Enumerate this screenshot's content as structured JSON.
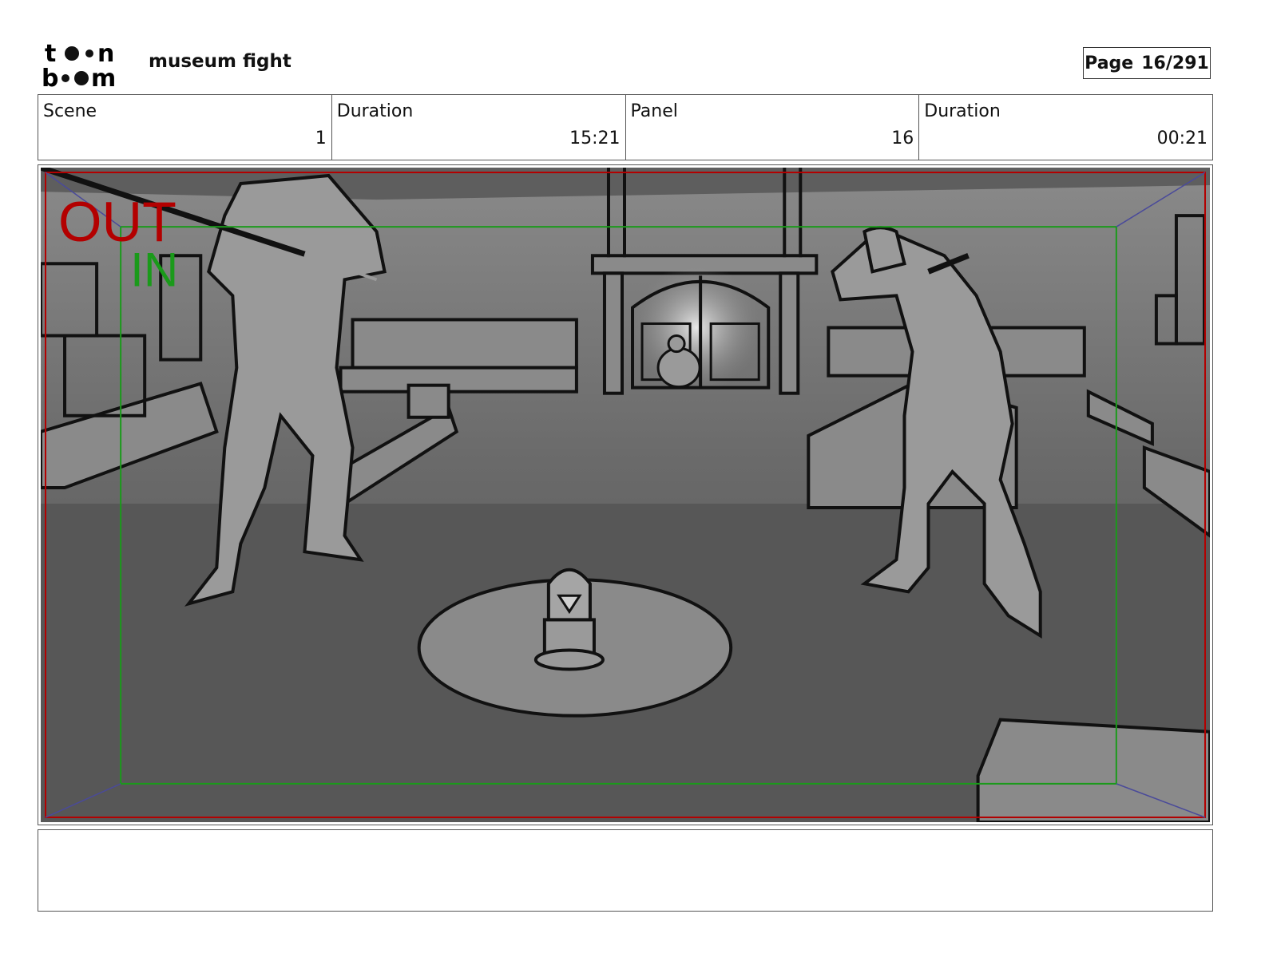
{
  "header": {
    "logo_text_top": "toon",
    "logo_text_bottom": "boom",
    "project_title": "museum fight",
    "page_label": "Page",
    "page_value": "16/291"
  },
  "info": {
    "scene_label": "Scene",
    "scene_value": "1",
    "scene_duration_label": "Duration",
    "scene_duration_value": "15:21",
    "panel_label": "Panel",
    "panel_value": "16",
    "panel_duration_label": "Duration",
    "panel_duration_value": "00:21"
  },
  "panel": {
    "out_marker": "OUT",
    "in_marker": "IN",
    "out_color": "#b30000",
    "in_color": "#1a9a1a"
  },
  "notes": {
    "text": ""
  }
}
